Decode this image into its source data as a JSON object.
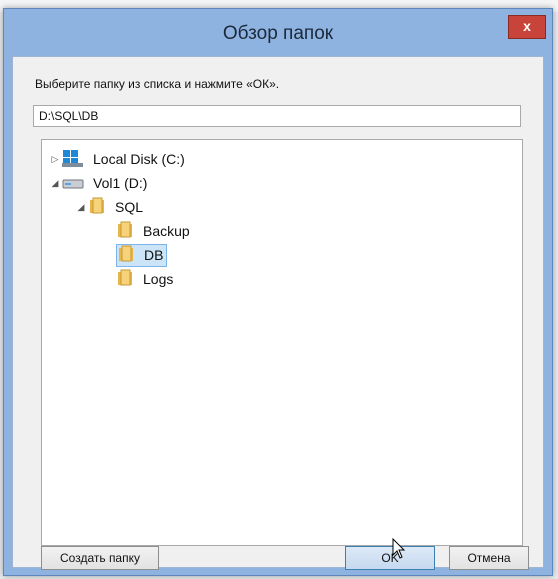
{
  "window": {
    "title": "Обзор папок",
    "close_label": "x"
  },
  "prompt": "Выберите папку из списка и нажмите «ОК».",
  "path": {
    "value": "D:\\SQL\\DB"
  },
  "tree": {
    "nodes": [
      {
        "label": "Local Disk (C:)",
        "expander": "▷",
        "icon": "local-disk-icon"
      },
      {
        "label": "Vol1 (D:)",
        "expander": "◢",
        "icon": "drive-icon"
      },
      {
        "label": "SQL",
        "expander": "◢",
        "icon": "folder-icon"
      },
      {
        "label": "Backup",
        "expander": "",
        "icon": "folder-icon"
      },
      {
        "label": "DB",
        "expander": "",
        "icon": "folder-open-icon",
        "selected": true
      },
      {
        "label": "Logs",
        "expander": "",
        "icon": "folder-icon"
      }
    ]
  },
  "buttons": {
    "new_folder": "Создать папку",
    "ok": "OK",
    "cancel": "Отмена"
  },
  "colors": {
    "titlebar": "#8fb3e0",
    "close": "#c8443a",
    "selection": "#cce4f7"
  }
}
